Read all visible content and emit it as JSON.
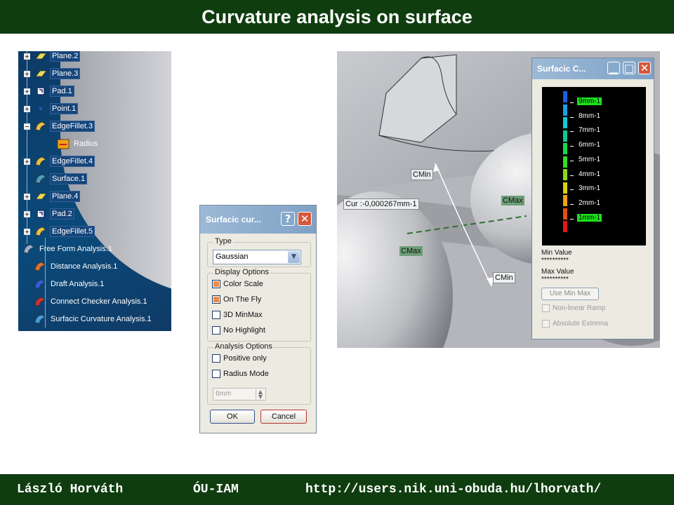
{
  "slide": {
    "title": "Curvature analysis on surface",
    "footer": {
      "author": "László Horváth",
      "institute": "ÓU-IAM",
      "url": "http://users.nik.uni-obuda.hu/lhorvath/"
    }
  },
  "tree": {
    "items": [
      {
        "label": "Plane.2",
        "icon": "plane-icon",
        "expander": "+"
      },
      {
        "label": "Plane.3",
        "icon": "plane-icon",
        "expander": "+"
      },
      {
        "label": "Pad.1",
        "icon": "pad-icon",
        "expander": "+"
      },
      {
        "label": "Point.1",
        "icon": "point-icon",
        "expander": "+"
      },
      {
        "label": "EdgeFillet.3",
        "icon": "edge-fillet-icon",
        "expander": "−"
      },
      {
        "label": "Radius",
        "icon": "radius-icon",
        "expander": ""
      },
      {
        "label": "EdgeFillet.4",
        "icon": "edge-fillet-icon",
        "expander": "+"
      },
      {
        "label": "Surface.1",
        "icon": "surface-icon",
        "expander": ""
      },
      {
        "label": "Plane.4",
        "icon": "plane-icon",
        "expander": "+"
      },
      {
        "label": "Pad.2",
        "icon": "pad-icon",
        "expander": "+"
      },
      {
        "label": "EdgeFillet.5",
        "icon": "edge-fillet-icon",
        "expander": "+"
      },
      {
        "label": "Free Form Analysis.1",
        "icon": "free-form-analysis-icon",
        "expander": ""
      },
      {
        "label": "Distance Analysis.1",
        "icon": "distance-analysis-icon",
        "expander": ""
      },
      {
        "label": "Draft Analysis.1",
        "icon": "draft-analysis-icon",
        "expander": ""
      },
      {
        "label": "Connect Checker Analysis.1",
        "icon": "connect-checker-icon",
        "expander": ""
      },
      {
        "label": "Surfacic Curvature Analysis.1",
        "icon": "surfacic-curvature-icon",
        "expander": ""
      }
    ]
  },
  "dialog_options": {
    "title": "Surfacic cur...",
    "help_glyph": "?",
    "close_glyph": "✕",
    "type_group": "Type",
    "type_value": "Gaussian",
    "display_group": "Display Options",
    "display_options": [
      {
        "label": "Color Scale",
        "checked": true
      },
      {
        "label": "On The Fly",
        "checked": true
      },
      {
        "label": "3D MinMax",
        "checked": false
      },
      {
        "label": "No Highlight",
        "checked": false
      }
    ],
    "analysis_group": "Analysis Options",
    "analysis_options": [
      {
        "label": "Positive only",
        "checked": false
      },
      {
        "label": "Radius Mode",
        "checked": false
      }
    ],
    "radius_value": "6mm",
    "ok_label": "OK",
    "cancel_label": "Cancel"
  },
  "view": {
    "cmin_top": "CMin",
    "cmin_bottom": "CMin",
    "cmax_right": "CMax",
    "cmax_left": "CMax",
    "cur_readout": "Cur :-0,000267mm-1"
  },
  "dialog_scale": {
    "title": "Surfacic C...",
    "colors": [
      "#1e5fe0",
      "#1aa0e8",
      "#12c8d8",
      "#10c890",
      "#18d84a",
      "#30e020",
      "#90d81c",
      "#d8d010",
      "#f0a010",
      "#e05010",
      "#e01818"
    ],
    "labels": [
      {
        "text": "9mm-1",
        "highlight": true
      },
      {
        "text": "8mm-1",
        "highlight": false
      },
      {
        "text": "7mm-1",
        "highlight": false
      },
      {
        "text": "6mm-1",
        "highlight": false
      },
      {
        "text": "5mm-1",
        "highlight": false
      },
      {
        "text": "4mm-1",
        "highlight": false
      },
      {
        "text": "3mm-1",
        "highlight": false
      },
      {
        "text": "2mm-1",
        "highlight": false
      },
      {
        "text": "1mm-1",
        "highlight": true
      }
    ],
    "min_label": "Min Value",
    "min_value": "**********",
    "max_label": "Max Value",
    "max_value": "**********",
    "use_min_max": "Use Min Max",
    "nonlinear_ramp": "Non-linear Ramp",
    "absolute_extrema": "Absolute Extrema"
  }
}
